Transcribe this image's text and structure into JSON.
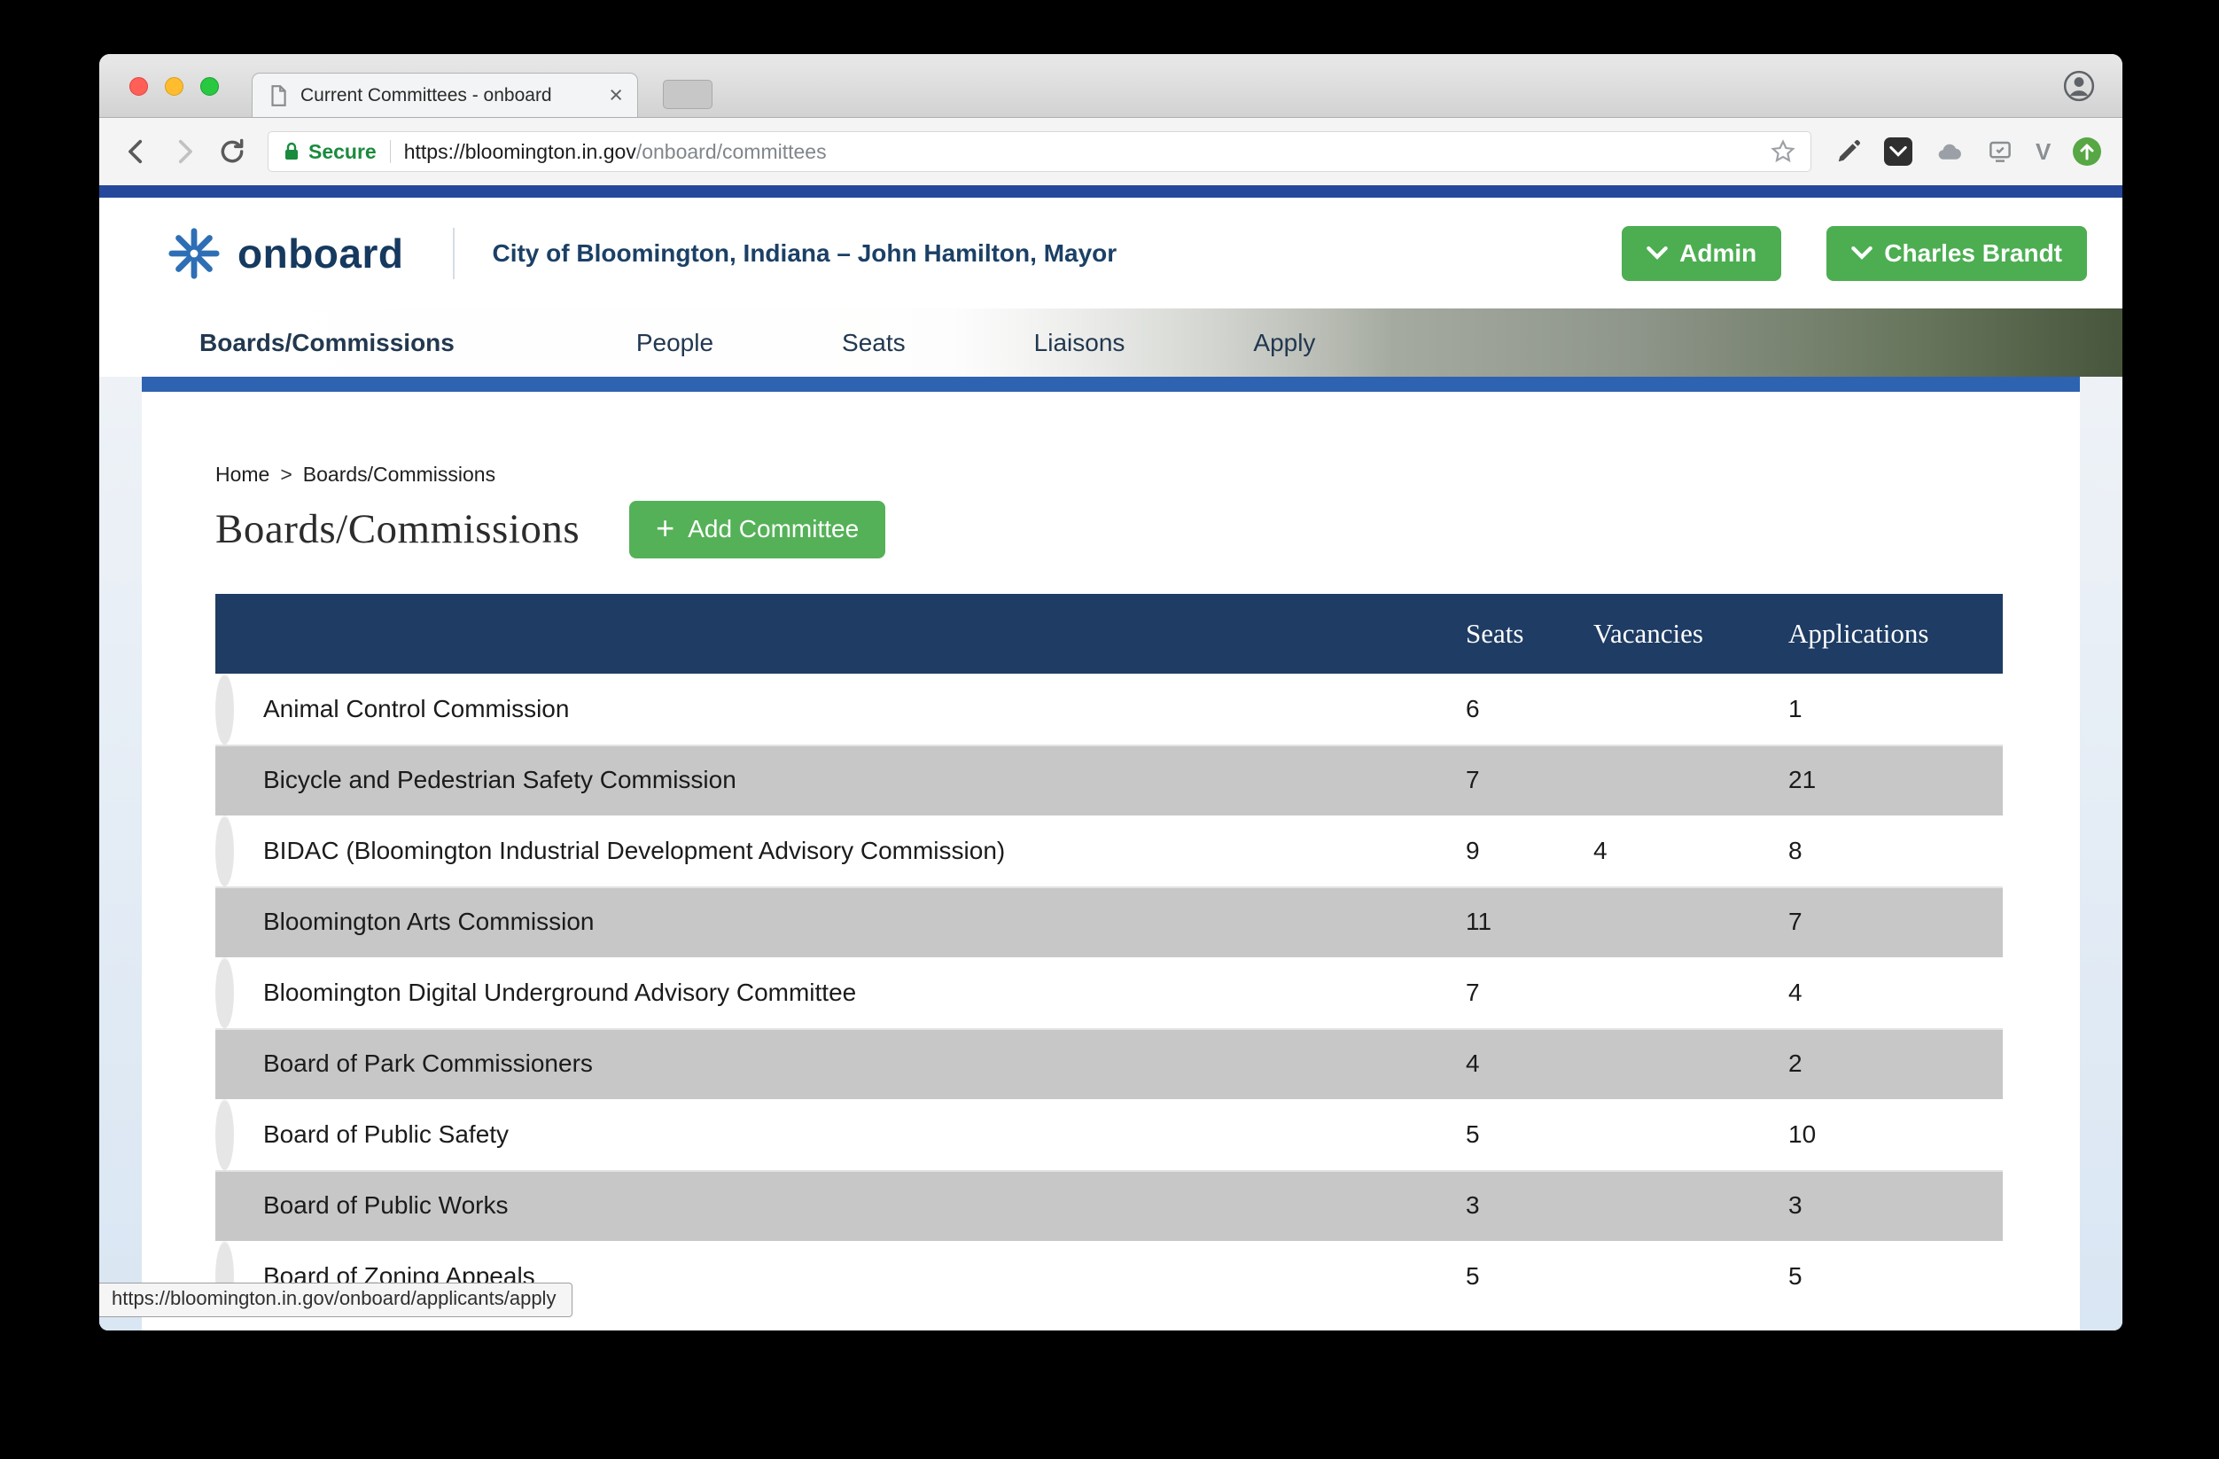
{
  "browser": {
    "tab": {
      "title": "Current Committees - onboard",
      "close_glyph": "×"
    },
    "address": {
      "secure_label": "Secure",
      "url_host": "https://bloomington.in.gov",
      "url_path": "/onboard/committees"
    },
    "status_bubble": "https://bloomington.in.gov/onboard/applicants/apply"
  },
  "site": {
    "logo_text": "onboard",
    "tagline": "City of Bloomington, Indiana – John Hamilton, Mayor",
    "admin_label": "Admin",
    "user_label": "Charles Brandt",
    "nav": [
      {
        "label": "Boards/Commissions",
        "active": true
      },
      {
        "label": "People",
        "active": false
      },
      {
        "label": "Seats",
        "active": false
      },
      {
        "label": "Liaisons",
        "active": false
      },
      {
        "label": "Apply",
        "active": false
      }
    ]
  },
  "page": {
    "breadcrumb": {
      "home": "Home",
      "separator": ">",
      "current": "Boards/Commissions"
    },
    "title": "Boards/Commissions",
    "add_plus": "+",
    "add_label": "Add Committee"
  },
  "table": {
    "columns": [
      "Seats",
      "Vacancies",
      "Applications"
    ],
    "rows": [
      {
        "name": "Animal Control Commission",
        "seats": "6",
        "vacancies": "",
        "applications": "1"
      },
      {
        "name": "Bicycle and Pedestrian Safety Commission",
        "seats": "7",
        "vacancies": "",
        "applications": "21"
      },
      {
        "name": "BIDAC (Bloomington Industrial Development Advisory Commission)",
        "seats": "9",
        "vacancies": "4",
        "applications": "8"
      },
      {
        "name": "Bloomington Arts Commission",
        "seats": "11",
        "vacancies": "",
        "applications": "7"
      },
      {
        "name": "Bloomington Digital Underground Advisory Committee",
        "seats": "7",
        "vacancies": "",
        "applications": "4"
      },
      {
        "name": "Board of Park Commissioners",
        "seats": "4",
        "vacancies": "",
        "applications": "2"
      },
      {
        "name": "Board of Public Safety",
        "seats": "5",
        "vacancies": "",
        "applications": "10"
      },
      {
        "name": "Board of Public Works",
        "seats": "3",
        "vacancies": "",
        "applications": "3"
      },
      {
        "name": "Board of Zoning Appeals",
        "seats": "5",
        "vacancies": "",
        "applications": "5"
      }
    ]
  },
  "colors": {
    "accent_green": "#4cae51",
    "table_header_navy": "#1e3c64",
    "top_blue_bar": "#26489c",
    "content_blue_bar": "#2e63b1",
    "secure_green": "#1a8a3e",
    "row_light": "#e6e6e6",
    "row_dark": "#c7c7c7"
  }
}
